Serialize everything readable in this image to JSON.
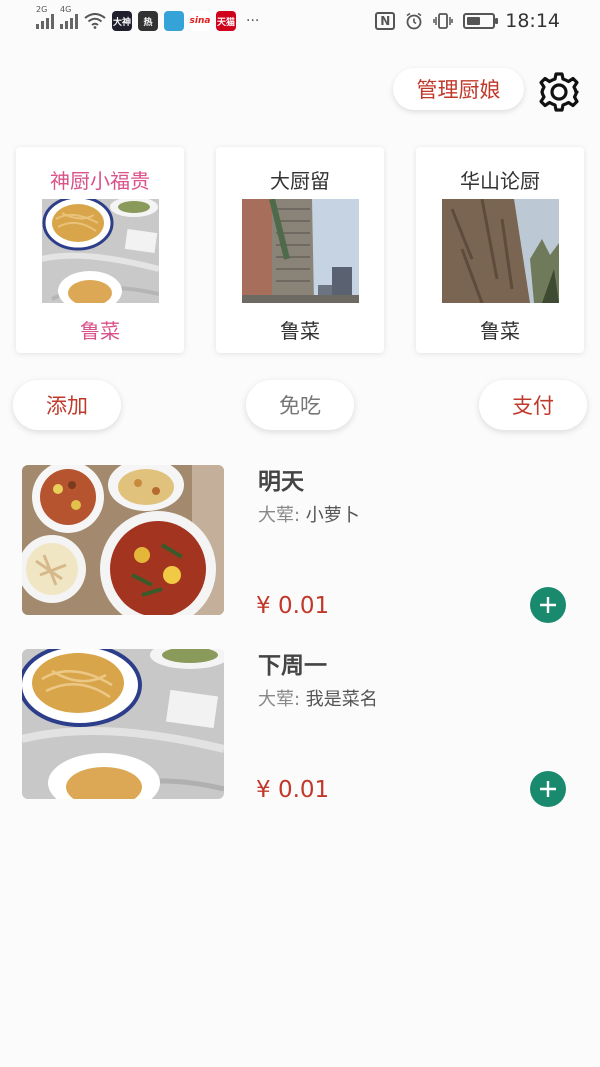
{
  "status_bar": {
    "signal1": "2G",
    "signal2": "4G",
    "apps": [
      {
        "label": "大神",
        "color": "#1f1f2e"
      },
      {
        "label": "热",
        "color": "#333333"
      },
      {
        "label": "",
        "color": "#35a3d8"
      },
      {
        "label": "sina",
        "color": "#e02020"
      },
      {
        "label": "天猫",
        "color": "#d0021b"
      }
    ],
    "more": "···",
    "nfc": "N",
    "time": "18:14"
  },
  "header": {
    "manage_label": "管理厨娘",
    "settings_icon": "gear-icon"
  },
  "chefs": [
    {
      "name": "神厨小福贵",
      "cuisine": "鲁菜",
      "active": true
    },
    {
      "name": "大厨留",
      "cuisine": "鲁菜",
      "active": false
    },
    {
      "name": "华山论厨",
      "cuisine": "鲁菜",
      "active": false
    }
  ],
  "actions": {
    "add": "添加",
    "free": "免吃",
    "pay": "支付"
  },
  "dishes": [
    {
      "title": "明天",
      "chef_label": "大荤: ",
      "chef_value": "小萝卜",
      "price": "¥ 0.01"
    },
    {
      "title": "下周一",
      "chef_label": "大荤: ",
      "chef_value": "我是菜名",
      "price": "¥ 0.01"
    }
  ],
  "colors": {
    "accent_red": "#c0392b",
    "active_pink": "#d9528a",
    "add_green": "#1a8a6e"
  }
}
